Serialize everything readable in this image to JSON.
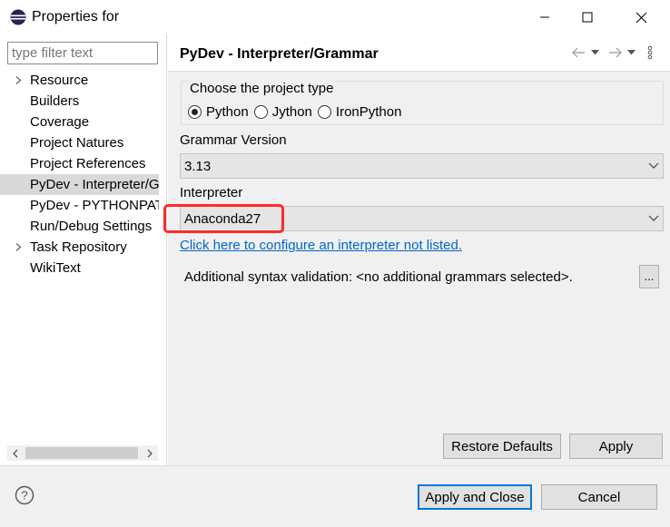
{
  "window": {
    "title": "Properties for",
    "icon": "eclipse-icon"
  },
  "sidebar": {
    "filter_placeholder": "type filter text",
    "items": [
      {
        "label": "Resource",
        "expandable": true
      },
      {
        "label": "Builders",
        "expandable": false
      },
      {
        "label": "Coverage",
        "expandable": false
      },
      {
        "label": "Project Natures",
        "expandable": false
      },
      {
        "label": "Project References",
        "expandable": false
      },
      {
        "label": "PyDev - Interpreter/Grammar",
        "expandable": false,
        "selected": true
      },
      {
        "label": "PyDev - PYTHONPATH",
        "expandable": false
      },
      {
        "label": "Run/Debug Settings",
        "expandable": false
      },
      {
        "label": "Task Repository",
        "expandable": true
      },
      {
        "label": "WikiText",
        "expandable": false
      }
    ]
  },
  "page": {
    "title": "PyDev - Interpreter/Grammar",
    "project_type": {
      "legend": "Choose the project type",
      "options": [
        "Python",
        "Jython",
        "IronPython"
      ],
      "selected": "Python"
    },
    "grammar": {
      "label": "Grammar Version",
      "value": "3.13"
    },
    "interpreter": {
      "label": "Interpreter",
      "value": "Anaconda27"
    },
    "configure_link": "Click here to configure an interpreter not listed.",
    "additional_syntax": "Additional syntax validation: <no additional grammars selected>.",
    "more_button": "...",
    "restore_defaults": "Restore Defaults",
    "apply": "Apply"
  },
  "footer": {
    "apply_and_close": "Apply and Close",
    "cancel": "Cancel"
  },
  "colors": {
    "highlight_border": "#ff2a2a",
    "link": "#0066cc",
    "default_button_border": "#0078d7"
  }
}
